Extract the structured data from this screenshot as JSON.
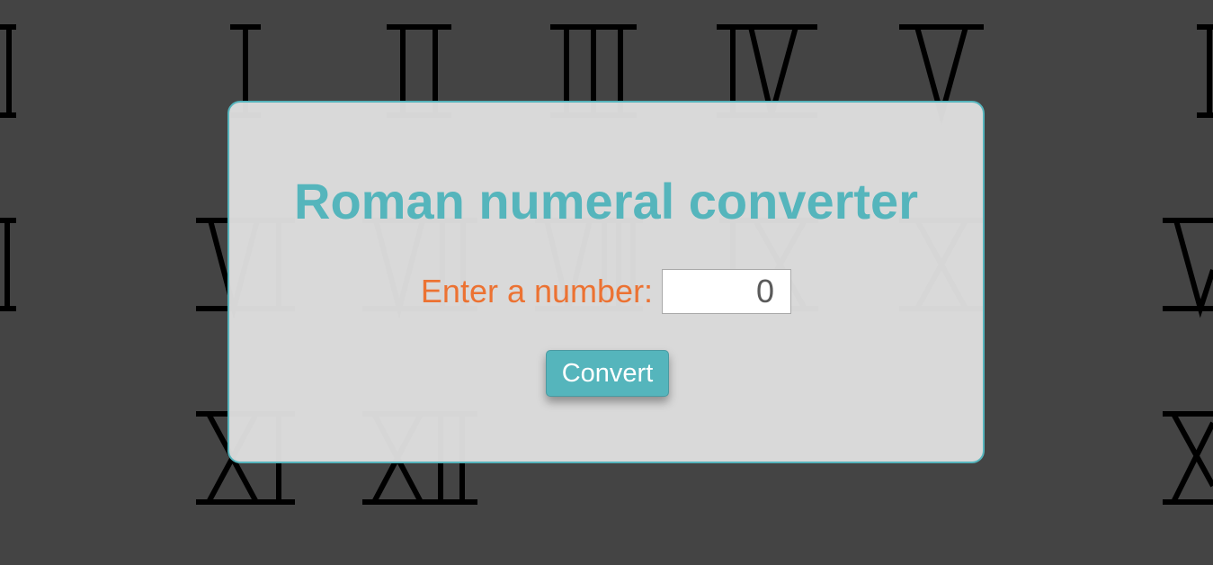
{
  "background": {
    "numerals": [
      "I",
      "II",
      "III",
      "IV",
      "V",
      "VI",
      "VII",
      "VIII",
      "IX",
      "X",
      "XI",
      "XII"
    ],
    "color": "#444444"
  },
  "converter": {
    "title": "Roman numeral converter",
    "input_label": "Enter a number:",
    "input_value": "0",
    "button_label": "Convert"
  },
  "colors": {
    "accent": "#55b5bc",
    "label": "#ec7232",
    "card_background": "#e2e2e2"
  }
}
